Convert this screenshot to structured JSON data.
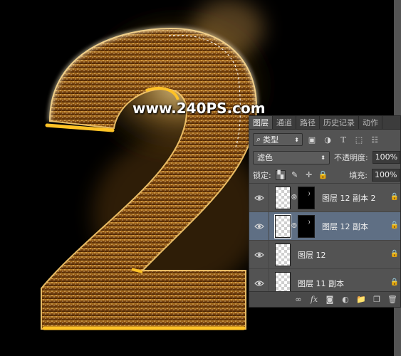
{
  "watermark": "www.240PS.com",
  "artwork": {
    "glyph": "2"
  },
  "colors": {
    "panel_bg": "#535353",
    "selected_layer": "#5f6f84",
    "gold_bright": "#ffc226",
    "gold_dark": "#7a3f05"
  },
  "panel": {
    "tabs": [
      {
        "label": "图层",
        "active": true
      },
      {
        "label": "通道",
        "active": false
      },
      {
        "label": "路径",
        "active": false
      },
      {
        "label": "历史记录",
        "active": false
      },
      {
        "label": "动作",
        "active": false
      }
    ],
    "filter": {
      "value": "类型",
      "icons": [
        "image-filter-icon",
        "adjustment-filter-icon",
        "type-filter-icon",
        "shape-filter-icon",
        "smart-object-filter-icon"
      ]
    },
    "blend_mode": "滤色",
    "opacity_label": "不透明度:",
    "opacity_value": "100%",
    "lock_label": "锁定:",
    "fill_label": "填充:",
    "fill_value": "100%",
    "layers": [
      {
        "name": "图层 12 副本 2",
        "has_mask": true,
        "selected": false,
        "locked": true
      },
      {
        "name": "图层 12 副本",
        "has_mask": true,
        "selected": true,
        "locked": true
      },
      {
        "name": "图层 12",
        "has_mask": false,
        "selected": false,
        "locked": true
      },
      {
        "name": "图层 11 副本",
        "has_mask": false,
        "selected": false,
        "locked": true
      }
    ],
    "bottom_icons": [
      "link-layers-icon",
      "fx-icon",
      "add-mask-icon",
      "adjustment-layer-icon",
      "new-group-icon",
      "new-layer-icon",
      "delete-icon"
    ],
    "fx_label": "fx"
  }
}
